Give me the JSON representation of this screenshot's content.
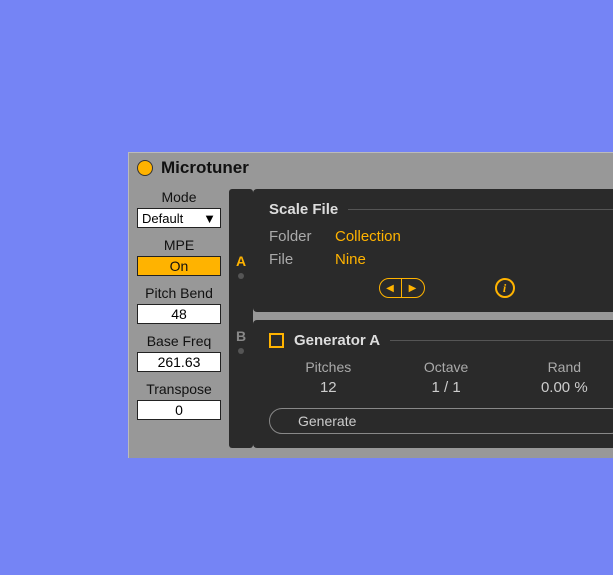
{
  "title": "Microtuner",
  "left": {
    "mode_label": "Mode",
    "mode_value": "Default",
    "mpe_label": "MPE",
    "mpe_value": "On",
    "pitchbend_label": "Pitch Bend",
    "pitchbend_value": "48",
    "basefreq_label": "Base Freq",
    "basefreq_value": "261.63",
    "transpose_label": "Transpose",
    "transpose_value": "0"
  },
  "tabs": {
    "a": "A",
    "b": "B"
  },
  "scale": {
    "section_title": "Scale File",
    "folder_label": "Folder",
    "folder_value": "Collection",
    "file_label": "File",
    "file_value": "Nine"
  },
  "generator": {
    "section_title": "Generator A",
    "pitches_label": "Pitches",
    "pitches_value": "12",
    "octave_label": "Octave",
    "octave_value": "1   /   1",
    "rand_label": "Rand",
    "rand_value": "0.00 %",
    "button": "Generate"
  }
}
